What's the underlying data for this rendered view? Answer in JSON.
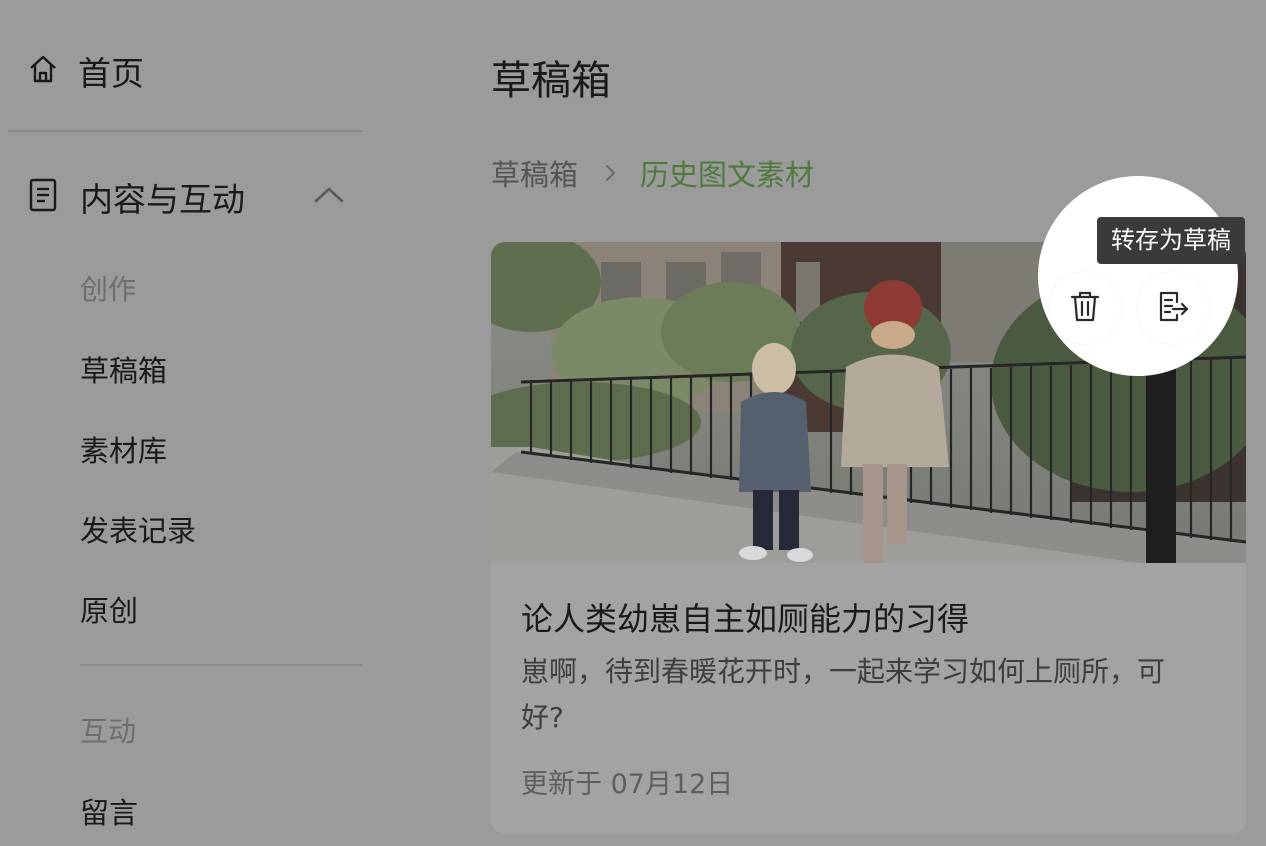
{
  "sidebar": {
    "home_label": "首页",
    "section_label": "内容与互动",
    "groups": [
      {
        "title": "创作",
        "items": [
          {
            "label": "草稿箱"
          },
          {
            "label": "素材库"
          },
          {
            "label": "发表记录"
          },
          {
            "label": "原创"
          }
        ]
      },
      {
        "title": "互动",
        "items": [
          {
            "label": "留言"
          }
        ]
      }
    ]
  },
  "main": {
    "page_title": "草稿箱",
    "breadcrumb": {
      "root": "草稿箱",
      "current": "历史图文素材"
    },
    "card": {
      "title": "论人类幼崽自主如厕能力的习得",
      "description": "崽啊，待到春暖花开时，一起来学习如何上厕所，可好?",
      "updated": "更新于 07月12日"
    },
    "tooltip": "转存为草稿"
  },
  "colors": {
    "accent_green": "#4f7a3c",
    "overlay_gray": "#9b9b9b"
  },
  "icons": [
    "home-icon",
    "document-icon",
    "chevron-up-icon",
    "chevron-right-icon",
    "trash-icon",
    "save-to-draft-icon"
  ]
}
